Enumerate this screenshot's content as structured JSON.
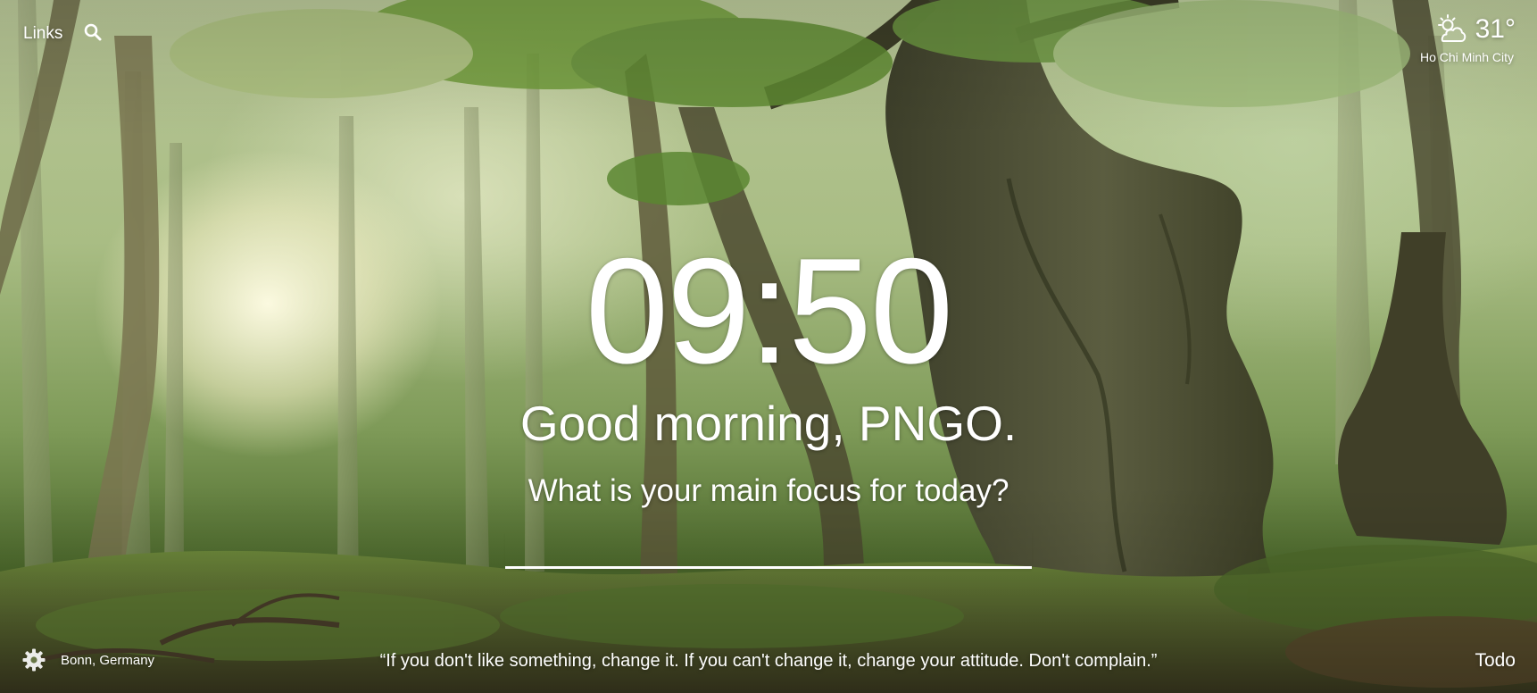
{
  "top_left": {
    "links_label": "Links",
    "search_icon": "search-icon"
  },
  "weather": {
    "icon": "partly-cloudy-icon",
    "temperature": "31°",
    "location": "Ho Chi Minh City"
  },
  "center": {
    "clock": "09:50",
    "greeting": "Good morning, PNGO.",
    "focus_prompt": "What is your main focus for today?",
    "focus_value": ""
  },
  "bottom": {
    "settings_icon": "gear-icon",
    "photo_location": "Bonn, Germany",
    "quote": "“If you don't like something, change it. If you can't change it, change your attitude. Don't complain.”",
    "todo_label": "Todo"
  },
  "colors": {
    "text": "#ffffff",
    "background_green": "#7e9a58"
  }
}
